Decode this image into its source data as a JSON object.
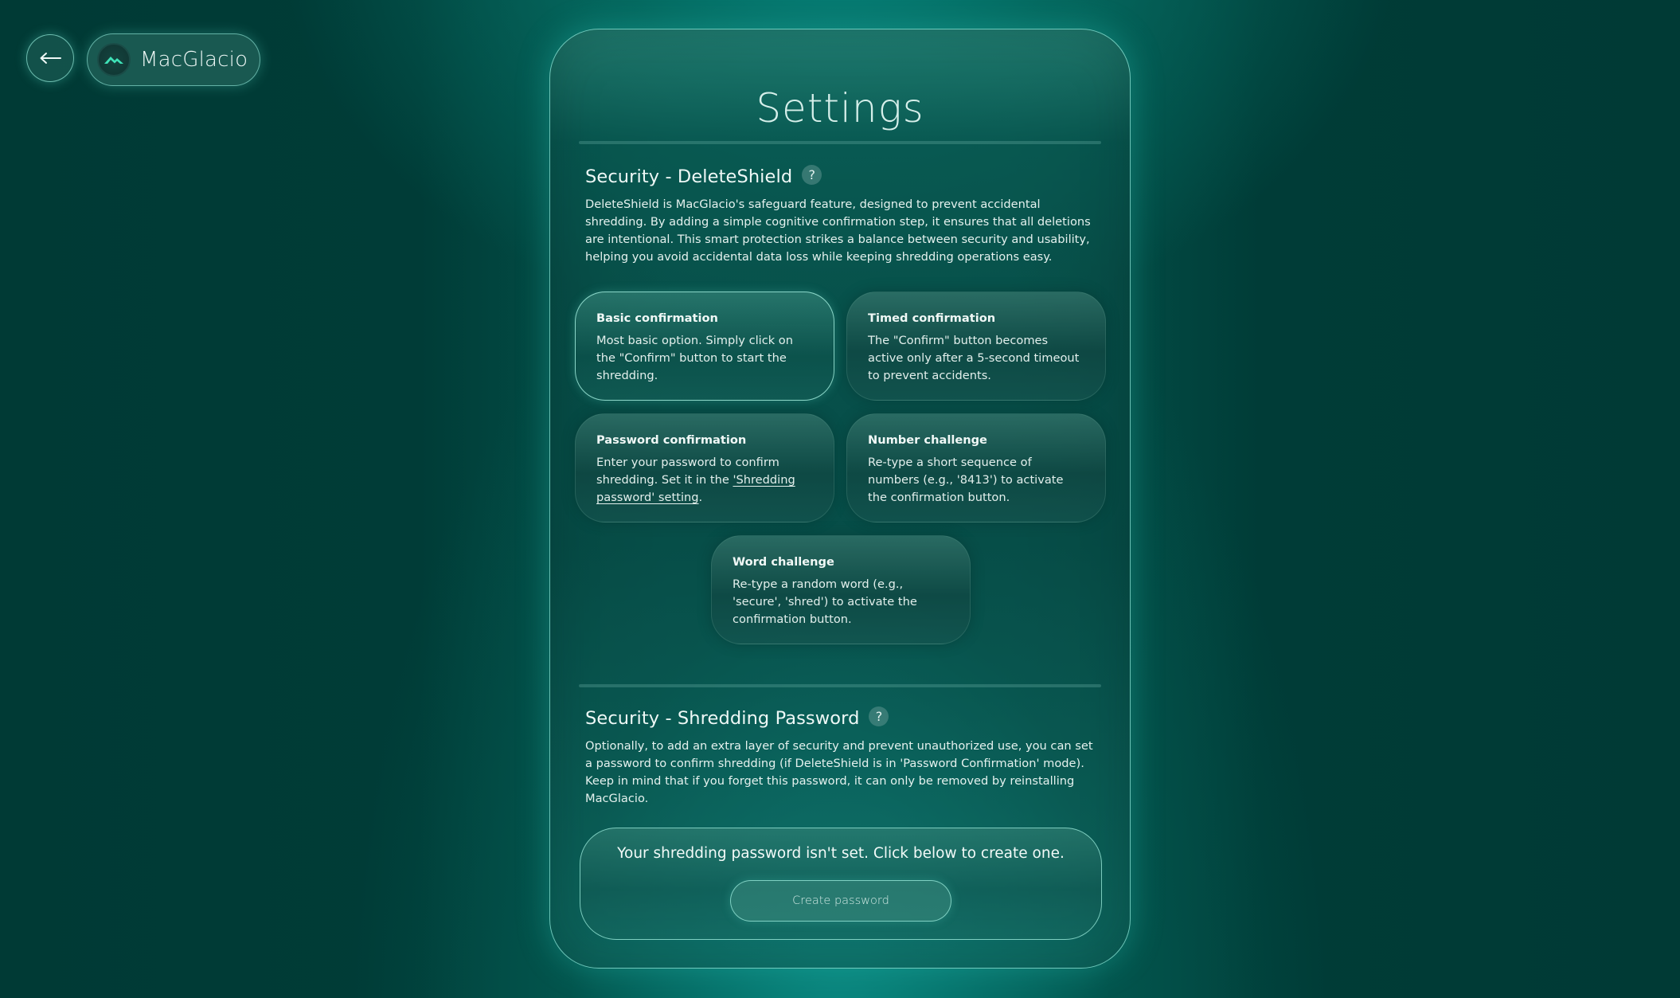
{
  "nav": {
    "back_icon": "arrow-left-icon",
    "app_name": "MacGlacio",
    "logo_icon": "mountain-icon",
    "accent_color": "#3fe3b8"
  },
  "panel": {
    "title": "Settings"
  },
  "deleteshield": {
    "title": "Security - DeleteShield",
    "help_label": "?",
    "description": "DeleteShield is MacGlacio's safeguard feature, designed to prevent accidental shredding. By adding a simple cognitive confirmation step, it ensures that all deletions are intentional. This smart protection strikes a balance between security and usability, helping you avoid accidental data loss while keeping shredding operations easy.",
    "selected_option": "Basic confirmation",
    "options": [
      {
        "title": "Basic confirmation",
        "description": "Most basic option. Simply click on the \"Confirm\" button to start the shredding.",
        "selected": true
      },
      {
        "title": "Timed confirmation",
        "description": "The \"Confirm\" button becomes active only after a 5-second timeout to prevent accidents.",
        "selected": false
      },
      {
        "title": "Password confirmation",
        "description_prefix": "Enter your password to confirm shredding. Set it in the ",
        "link_text": "'Shredding password' setting",
        "description_suffix": ".",
        "selected": false
      },
      {
        "title": "Number challenge",
        "description": "Re-type a short sequence of numbers (e.g., '8413') to activate the confirmation button.",
        "selected": false
      },
      {
        "title": "Word challenge",
        "description": "Re-type a random word (e.g., 'secure', 'shred') to activate the confirmation button.",
        "selected": false
      }
    ]
  },
  "shredding_password": {
    "title": "Security - Shredding Password",
    "help_label": "?",
    "description": "Optionally, to add an extra layer of security and prevent unauthorized use, you can set a password to confirm shredding (if DeleteShield is in 'Password Confirmation' mode). Keep in mind that if you forget this password, it can only be removed by reinstalling MacGlacio.",
    "status_message": "Your shredding password isn't set. Click below to create one.",
    "create_button_label": "Create password"
  }
}
